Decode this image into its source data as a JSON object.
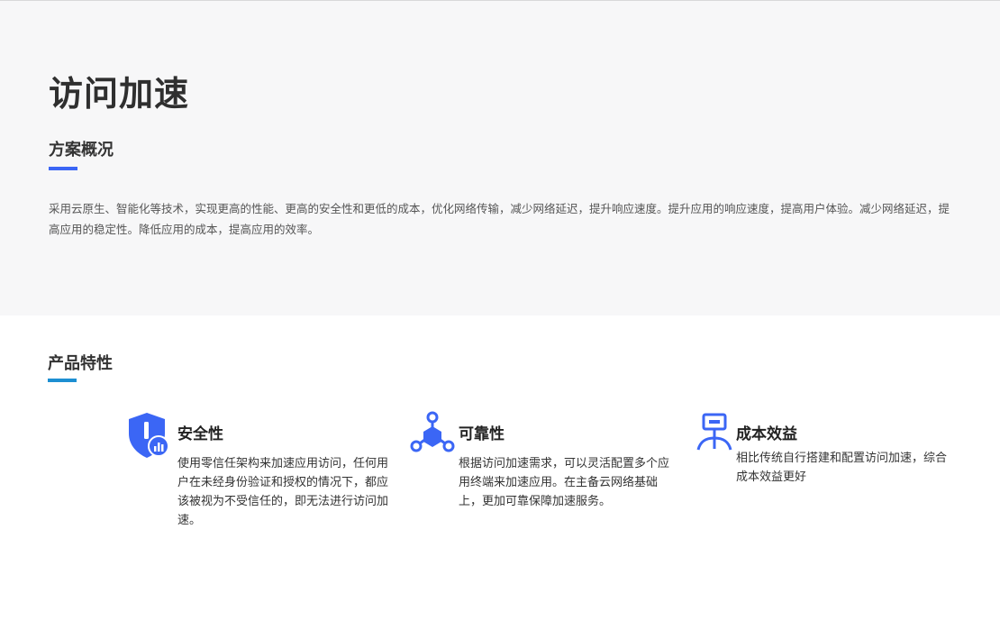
{
  "page": {
    "title": "访问加速"
  },
  "overview": {
    "title": "方案概况",
    "text": "采用云原生、智能化等技术，实现更高的性能、更高的安全性和更低的成本，优化网络传输，减少网络延迟，提升响应速度。提升应用的响应速度，提高用户体验。减少网络延迟，提高应用的稳定性。降低应用的成本，提高应用的效率。"
  },
  "features": {
    "title": "产品特性",
    "items": [
      {
        "icon": "shield-chart-icon",
        "title": "安全性",
        "description": "使用零信任架构来加速应用访问，任何用户在未经身份验证和授权的情况下，都应该被视为不受信任的，即无法进行访问加速。"
      },
      {
        "icon": "network-nodes-icon",
        "title": "可靠性",
        "description": "根据访问加速需求，可以灵活配置多个应用终端来加速应用。在主备云网络基础上，更加可靠保障加速服务。"
      },
      {
        "icon": "server-network-icon",
        "title": "成本效益",
        "description": "相比传统自行搭建和配置访问加速，综合成本效益更好"
      }
    ]
  },
  "colors": {
    "accent_blue": "#3b66f5",
    "accent_teal": "#1d8fd2",
    "hero_bg": "#f7f7f8"
  }
}
